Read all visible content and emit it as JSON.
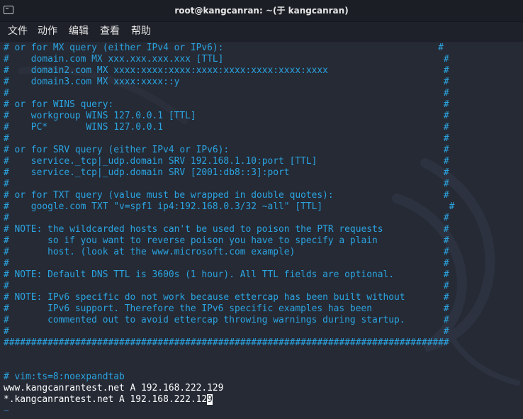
{
  "window": {
    "title": "root@kangcanran: ~(于 kangcanran)"
  },
  "menubar": {
    "items": [
      "文件",
      "动作",
      "编辑",
      "查看",
      "帮助"
    ]
  },
  "terminal": {
    "comment_lines": [
      "# or for MX query (either IPv4 or IPv6):                                       #",
      "#    domain.com MX xxx.xxx.xxx.xxx [TTL]                                        #",
      "#    domain2.com MX xxxx:xxxx:xxxx:xxxx:xxxx:xxxx:xxxx:xxxx                     #",
      "#    domain3.com MX xxxx:xxxx::y                                                #",
      "#                                                                               #",
      "# or for WINS query:                                                            #",
      "#    workgroup WINS 127.0.0.1 [TTL]                                             #",
      "#    PC*       WINS 127.0.0.1                                                   #",
      "#                                                                               #",
      "# or for SRV query (either IPv4 or IPv6):                                       #",
      "#    service._tcp|_udp.domain SRV 192.168.1.10:port [TTL]                       #",
      "#    service._tcp|_udp.domain SRV [2001:db8::3]:port                            #",
      "#                                                                               #",
      "# or for TXT query (value must be wrapped in double quotes):                    #",
      "#    google.com TXT \"v=spf1 ip4:192.168.0.3/32 ~all\" [TTL]                       #",
      "#                                                                               #",
      "# NOTE: the wildcarded hosts can't be used to poison the PTR requests           #",
      "#       so if you want to reverse poison you have to specify a plain            #",
      "#       host. (look at the www.microsoft.com example)                           #",
      "#                                                                               #",
      "# NOTE: Default DNS TTL is 3600s (1 hour). All TTL fields are optional.         #",
      "#                                                                               #",
      "# NOTE: IPv6 specific do not work because ettercap has been built without       #",
      "#       IPv6 support. Therefore the IPv6 specific examples has been             #",
      "#       commented out to avoid ettercap throwing warnings during startup.       #",
      "#                                                                               #",
      "#################################################################################"
    ],
    "blank_lines": [
      "",
      ""
    ],
    "modeline": "# vim:ts=8:noexpandtab",
    "entry1": "www.kangcanrantest.net A 192.168.222.129",
    "entry2_before_cursor": "*.kangcanrantest.net A 192.168.222.12",
    "entry2_cursor_char": "9",
    "tilde": "~"
  },
  "colors": {
    "comment": "#2ba4e0",
    "text": "#ffffff",
    "background": "#252a35",
    "tilde": "#3b6fb0"
  }
}
